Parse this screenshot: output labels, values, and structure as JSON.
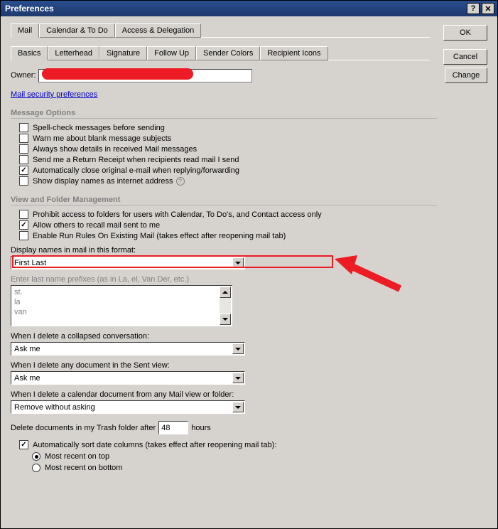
{
  "title": "Preferences",
  "buttons": {
    "ok": "OK",
    "cancel": "Cancel",
    "change": "Change"
  },
  "tabs_main": {
    "mail": "Mail",
    "calendar": "Calendar & To Do",
    "access": "Access & Delegation"
  },
  "tabs_sub": {
    "basics": "Basics",
    "letterhead": "Letterhead",
    "signature": "Signature",
    "followup": "Follow Up",
    "sender": "Sender Colors",
    "recipient": "Recipient Icons"
  },
  "owner": {
    "label": "Owner:",
    "value": ""
  },
  "link_security": "Mail security preferences",
  "groups": {
    "msg": {
      "title": "Message Options",
      "spell": "Spell-check messages before sending",
      "blank": "Warn me about blank message subjects",
      "details": "Always show details in received Mail messages",
      "receipt": "Send me a Return Receipt when recipients read mail I send",
      "autoclose": "Automatically close original e-mail when replying/forwarding",
      "internet": "Show display names as internet address"
    },
    "view": {
      "title": "View and Folder Management",
      "prohibit": "Prohibit access to folders for users with Calendar, To Do's, and Contact access only",
      "recall": "Allow others to recall mail sent to me",
      "runrules": "Enable Run Rules On Existing Mail (takes effect after reopening mail tab)",
      "displayfmt_label": "Display names in mail in this format:",
      "displayfmt_value": "First Last",
      "prefixes_label": "Enter last name prefixes (as in La, el, Van Der, etc.)",
      "prefixes_items": [
        "st.",
        "la",
        "van"
      ],
      "del_collapsed_label": "When I delete a collapsed conversation:",
      "del_collapsed_value": "Ask me",
      "del_sent_label": "When I delete any document in the Sent view:",
      "del_sent_value": "Ask me",
      "del_cal_label": "When I delete a calendar document from any Mail view or folder:",
      "del_cal_value": "Remove without asking",
      "trash_pre": "Delete documents in my Trash folder after",
      "trash_value": "48",
      "trash_post": "hours",
      "autosort": "Automatically sort date columns (takes effect after reopening mail tab):",
      "radio_top": "Most recent on top",
      "radio_bottom": "Most recent on bottom"
    }
  }
}
